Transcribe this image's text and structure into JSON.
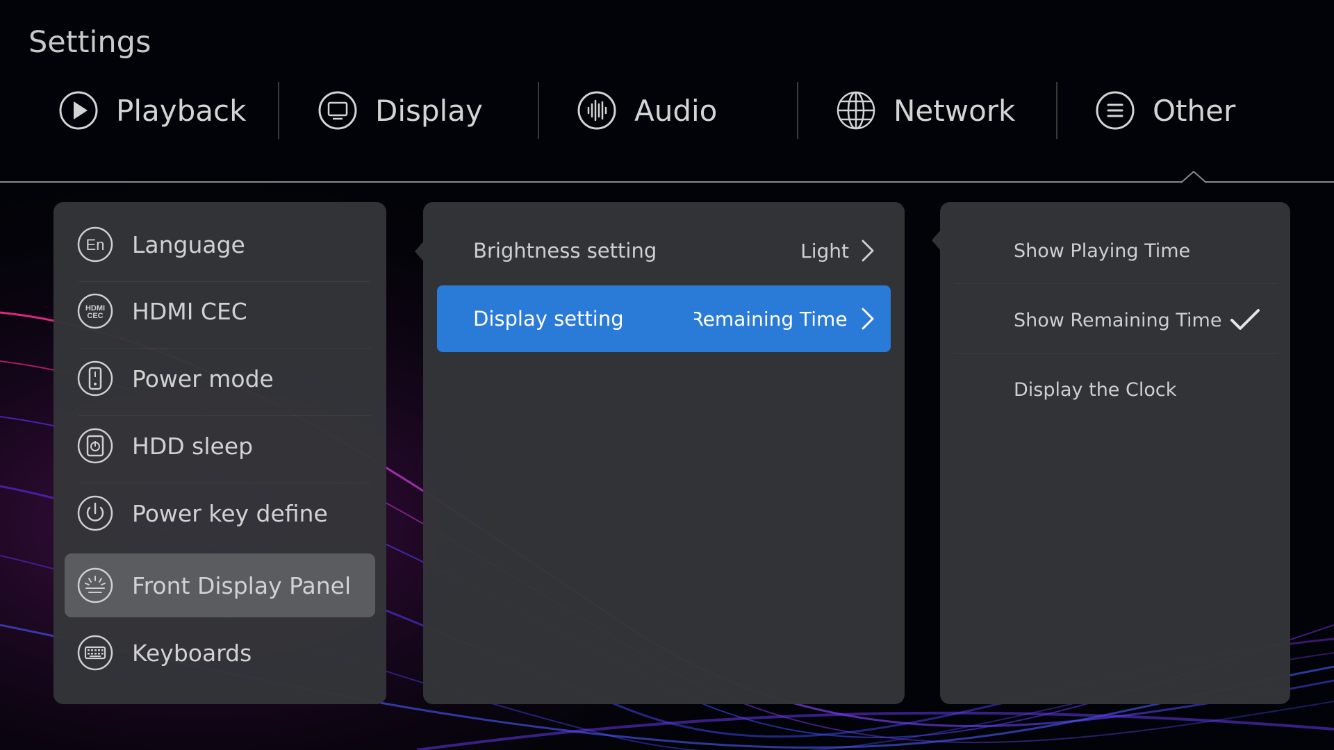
{
  "header": {
    "title": "Settings"
  },
  "tabs": [
    {
      "label": "Playback",
      "icon": "play-circle-icon"
    },
    {
      "label": "Display",
      "icon": "monitor-icon"
    },
    {
      "label": "Audio",
      "icon": "audio-waveform-icon"
    },
    {
      "label": "Network",
      "icon": "globe-icon"
    },
    {
      "label": "Other",
      "icon": "menu-lines-icon",
      "active": true
    }
  ],
  "sidebar": {
    "items": [
      {
        "label": "Language",
        "icon": "language-en-icon",
        "icon_text": "En"
      },
      {
        "label": "HDMI CEC",
        "icon": "hdmi-cec-icon",
        "icon_text_top": "HDMI",
        "icon_text_bottom": "CEC"
      },
      {
        "label": "Power mode",
        "icon": "power-mode-icon"
      },
      {
        "label": "HDD sleep",
        "icon": "hdd-sleep-icon"
      },
      {
        "label": "Power key define",
        "icon": "power-icon"
      },
      {
        "label": "Front Display Panel",
        "icon": "front-display-icon",
        "selected": true
      },
      {
        "label": "Keyboards",
        "icon": "keyboard-icon"
      }
    ]
  },
  "middle": {
    "rows": [
      {
        "label": "Brightness setting",
        "value": "Light"
      },
      {
        "label": "Display setting",
        "value": "Show Remaining Time",
        "active": true
      }
    ]
  },
  "options": {
    "items": [
      {
        "label": "Show Playing Time",
        "checked": false
      },
      {
        "label": "Show Remaining Time",
        "checked": true
      },
      {
        "label": "Display the Clock",
        "checked": false
      }
    ]
  },
  "colors": {
    "accent": "#2a7ad8",
    "panel": "#343539",
    "background": "#020308"
  }
}
